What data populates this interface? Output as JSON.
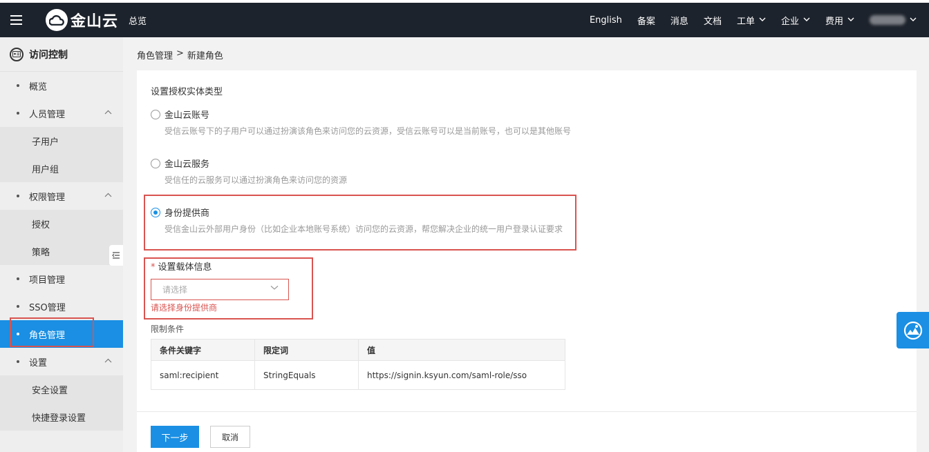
{
  "header": {
    "logo_text": "金山云",
    "overview": "总览",
    "nav": [
      {
        "label": "English",
        "dropdown": false
      },
      {
        "label": "备案",
        "dropdown": false
      },
      {
        "label": "消息",
        "dropdown": false
      },
      {
        "label": "文档",
        "dropdown": false
      },
      {
        "label": "工单",
        "dropdown": true
      },
      {
        "label": "企业",
        "dropdown": true
      },
      {
        "label": "费用",
        "dropdown": true
      }
    ],
    "chevron": "⌄"
  },
  "sidebar": {
    "title": "访问控制",
    "items": [
      {
        "label": "概览"
      },
      {
        "label": "人员管理",
        "expanded": true
      },
      {
        "label": "子用户",
        "sub": true
      },
      {
        "label": "用户组",
        "sub": true
      },
      {
        "label": "权限管理",
        "expanded": true
      },
      {
        "label": "授权",
        "sub": true
      },
      {
        "label": "策略",
        "sub": true
      },
      {
        "label": "项目管理"
      },
      {
        "label": "SSO管理"
      },
      {
        "label": "角色管理",
        "active": true
      },
      {
        "label": "设置",
        "expanded": true
      },
      {
        "label": "安全设置",
        "sub": true
      },
      {
        "label": "快捷登录设置",
        "sub": true
      }
    ]
  },
  "breadcrumb": {
    "parent": "角色管理",
    "separator": ">",
    "current": "新建角色"
  },
  "form": {
    "section_title": "设置授权实体类型",
    "options": [
      {
        "label": "金山云账号",
        "desc": "受信云账号下的子用户可以通过扮演该角色来访问您的云资源，受信云账号可以是当前账号，也可以是其他账号",
        "checked": false
      },
      {
        "label": "金山云服务",
        "desc": "受信任的云服务可以通过扮演角色来访问您的资源",
        "checked": false
      },
      {
        "label": "身份提供商",
        "desc": "受信金山云外部用户身份（比如企业本地账号系统）访问您的云资源，帮您解决企业的统一用户登录认证要求",
        "checked": true
      }
    ],
    "carrier_label": "设置载体信息",
    "required_mark": "*",
    "select_placeholder": "请选择",
    "error_text": "请选择身份提供商",
    "limit_label": "限制条件",
    "table": {
      "headers": [
        "条件关键字",
        "限定词",
        "值"
      ],
      "rows": [
        [
          "saml:recipient",
          "StringEquals",
          "https://signin.ksyun.com/saml-role/sso"
        ]
      ]
    },
    "next_button": "下一步",
    "cancel_button": "取消"
  },
  "colors": {
    "accent": "#1a8fe3",
    "error": "#d9534f",
    "topbar": "#1d232c"
  }
}
